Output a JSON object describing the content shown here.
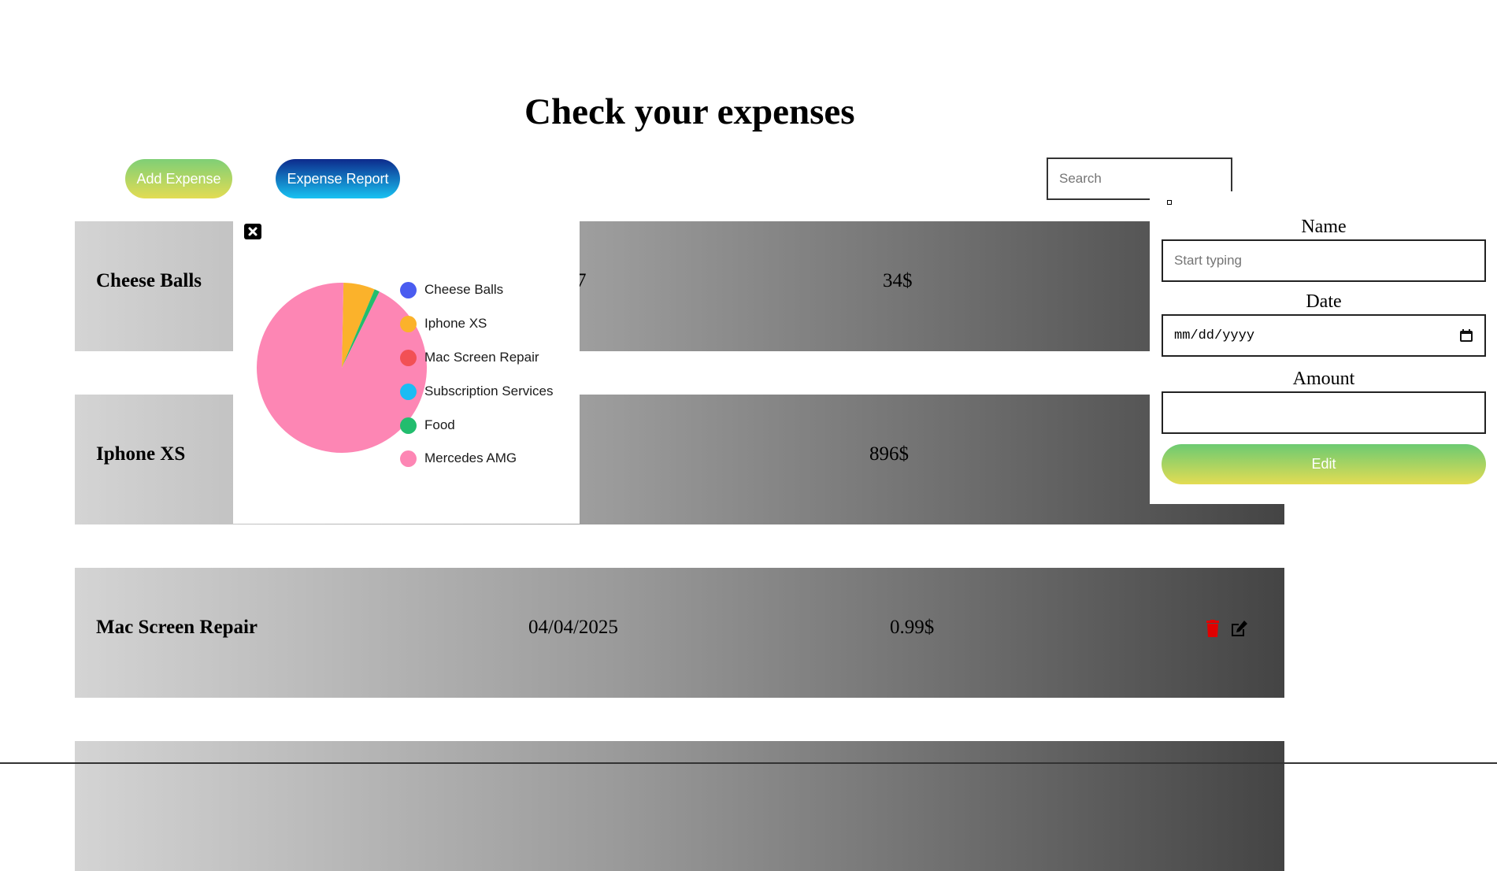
{
  "header": {
    "title": "Check your expenses"
  },
  "toolbar": {
    "add_expense_label": "Add Expense",
    "expense_report_label": "Expense Report",
    "search_placeholder": "Search"
  },
  "expenses": [
    {
      "name": "Cheese Balls",
      "date": "7",
      "amount": "34$"
    },
    {
      "name": "Iphone XS",
      "date": "",
      "amount": "896$"
    },
    {
      "name": "Mac Screen Repair",
      "date": "04/04/2025",
      "amount": "0.99$"
    },
    {
      "name": "",
      "date": "",
      "amount": ""
    }
  ],
  "report": {
    "legend": [
      {
        "label": "Cheese Balls",
        "color": "#4a5cf0"
      },
      {
        "label": "Iphone XS",
        "color": "#fbb22b"
      },
      {
        "label": "Mac Screen Repair",
        "color": "#f25055"
      },
      {
        "label": "Subscription Services",
        "color": "#1bbcf4"
      },
      {
        "label": "Food",
        "color": "#22bd6e"
      },
      {
        "label": "Mercedes AMG",
        "color": "#fd86b4"
      }
    ]
  },
  "chart_data": {
    "type": "pie",
    "title": "",
    "slices": [
      {
        "label": "Cheese Balls",
        "value": 0,
        "color": "#4a5cf0"
      },
      {
        "label": "Iphone XS",
        "value": 6,
        "color": "#fbb22b"
      },
      {
        "label": "Mac Screen Repair",
        "value": 0,
        "color": "#f25055"
      },
      {
        "label": "Subscription Services",
        "value": 0,
        "color": "#1bbcf4"
      },
      {
        "label": "Food",
        "value": 1,
        "color": "#22bd6e"
      },
      {
        "label": "Mercedes AMG",
        "value": 93,
        "color": "#fd86b4"
      }
    ]
  },
  "edit_form": {
    "name_label": "Name",
    "name_placeholder": "Start typing",
    "date_label": "Date",
    "date_placeholder": "mm/dd/yyyy",
    "amount_label": "Amount",
    "amount_value": "",
    "edit_label": "Edit"
  },
  "colors": {
    "delete": "#e00000",
    "edit": "#000000"
  }
}
